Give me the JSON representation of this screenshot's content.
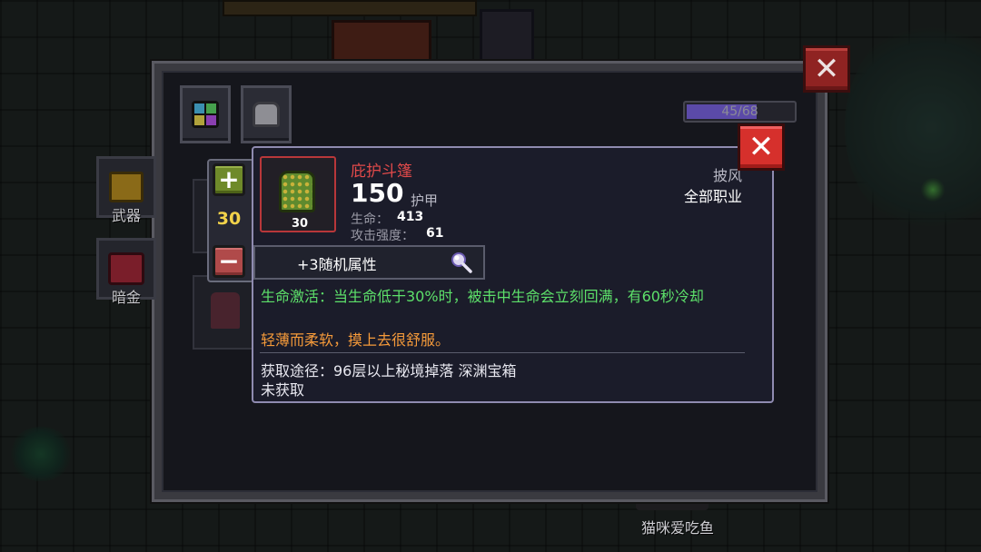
{
  "inventory": {
    "count": "45/68",
    "count_fraction": 0.662
  },
  "categories": [
    {
      "label": "武器",
      "icon": "weapon-icon"
    },
    {
      "label": "暗金",
      "icon": "dark-gold-icon"
    }
  ],
  "tabs": [
    {
      "icon": "gem-grid-icon"
    },
    {
      "icon": "armor-icon"
    }
  ],
  "stepper": {
    "value": "30"
  },
  "item": {
    "name": "庇护斗篷",
    "level": "30",
    "armor_value": "150",
    "armor_label": "护甲",
    "stats": [
      {
        "label": "生命：",
        "value": "413"
      },
      {
        "label": "攻击强度：",
        "value": "61"
      }
    ],
    "type": "披风",
    "class": "全部职业",
    "random_attributes": "+3随机属性",
    "effect": "生命激活：当生命低于30%时，被击中生命会立刻回满，有60秒冷却",
    "flavor": "轻薄而柔软，摸上去很舒服。",
    "source": "获取途径：96层以上秘境掉落 深渊宝箱",
    "status": "未获取"
  },
  "npc": {
    "label": "猫咪爱吃鱼"
  },
  "colors": {
    "item_name": "#e24a4a",
    "effect": "#5de06a",
    "flavor": "#f59a3a",
    "stepper_value": "#f2d24a",
    "close_button": "#d6302c"
  }
}
